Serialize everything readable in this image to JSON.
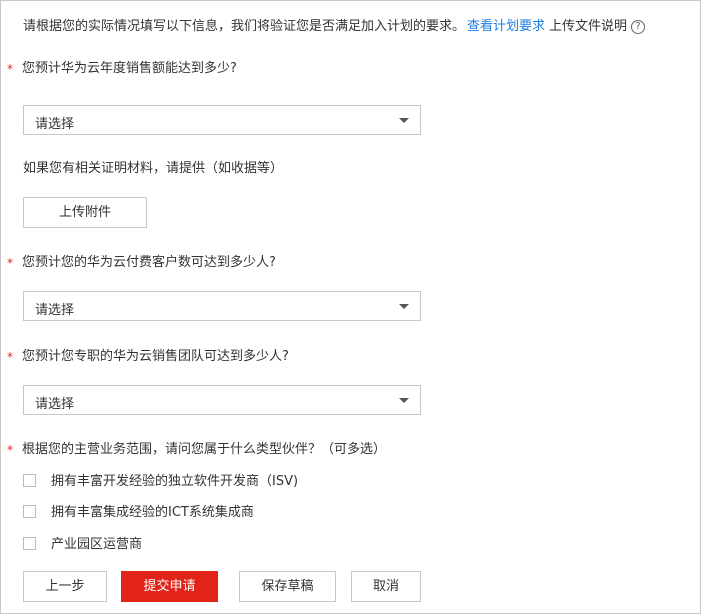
{
  "intro": {
    "text": "请根据您的实际情况填写以下信息，我们将验证您是否满足加入计划的要求。",
    "link": "查看计划要求",
    "upload_note": "上传文件说明",
    "help_icon": "?"
  },
  "required_mark": "*",
  "questions": [
    {
      "label": "您预计华为云年度销售额能达到多少?",
      "select_value": "请选择"
    },
    {
      "label": "您预计您的华为云付费客户数可达到多少人?",
      "select_value": "请选择"
    },
    {
      "label": "您预计您专职的华为云销售团队可达到多少人?",
      "select_value": "请选择"
    },
    {
      "label": "根据您的主营业务范围，请问您属于什么类型伙伴？（可多选）"
    }
  ],
  "evidence": {
    "hint": "如果您有相关证明材料，请提供（如收据等）",
    "upload_button": "上传附件"
  },
  "partner_types": [
    {
      "label": "拥有丰富开发经验的独立软件开发商（ISV)",
      "checked": false
    },
    {
      "label": "拥有丰富集成经验的ICT系统集成商",
      "checked": false
    },
    {
      "label": "产业园区运营商",
      "checked": false
    }
  ],
  "actions": {
    "prev": "上一步",
    "submit": "提交申请",
    "save_draft": "保存草稿",
    "cancel": "取消"
  },
  "colors": {
    "accent_red": "#e2231a",
    "link_blue": "#1e7ee0"
  }
}
